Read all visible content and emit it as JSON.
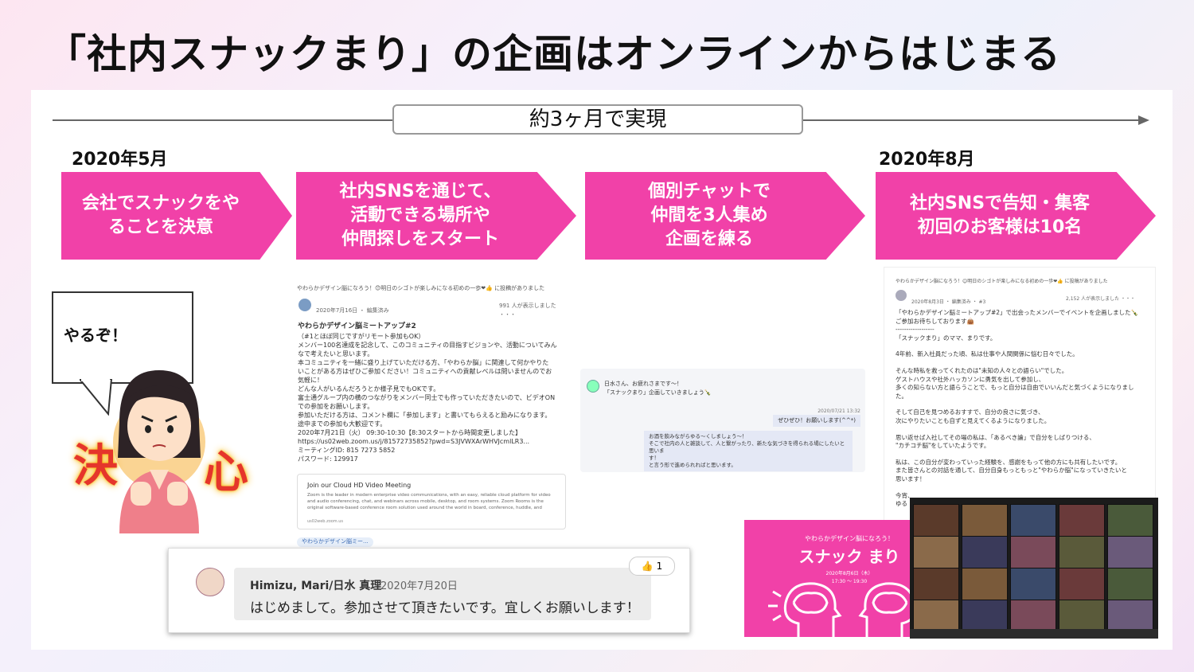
{
  "title": "「社内スナックまり」の企画はオンラインからはじまる",
  "timeline": {
    "label": "約3ヶ月で実現",
    "start_date": "2020年5月",
    "end_date": "2020年8月"
  },
  "steps": [
    {
      "text": "会社でスナックをや\nることを決意"
    },
    {
      "text": "社内SNSを通じて、\n活動できる場所や\n仲間探しをスタート"
    },
    {
      "text": "個別チャットで\n仲間を3人集め\n企画を練る"
    },
    {
      "text": "社内SNSで告知・集客\n初回のお客様は10名"
    }
  ],
  "illustration": {
    "speech": "やるぞ！",
    "kanji_left": "決",
    "kanji_right": "心"
  },
  "sns_post1": {
    "header": "やわらかデザイン脳になろう！😊明日のシゴトが楽しみになる初めの一歩❤👍 に投稿がありました",
    "meta": "2020年7月16日 ・ 編集済み",
    "views": "991 人が表示しました ・・・",
    "heading": "やわらかデザイン脳ミートアップ#2",
    "lines": [
      "（#1とほぼ同じですがリモート参加もOK）",
      "メンバー100名達成を記念して、このコミュニティの目指すビジョンや、活動についてみん",
      "なで考えたいと思います。",
      "本コミュニティを一緒に盛り上げていただける方、「やわらか脳」に関連して何かやりた",
      "いことがある方はぜひご参加ください！コミュニティへの貢献レベルは問いませんのでお",
      "気軽に！",
      "どんな人がいるんだろうとか様子見でもOKです。",
      "富士通グループ内の横のつながりをメンバー同士でも作っていただきたいので、ビデオON",
      "での参加をお願いします。",
      "参加いただける方は、コメント欄に「参加します」と書いてもらえると励みになります。",
      "途中までの参加も大歓迎です。",
      "2020年7月21日（火） 09:30-10:30【8:30スタートから時間変更しました】",
      "https://us02web.zoom.us/j/81572735852?pwd=S3JVWXArWHVJcmlLR3...",
      "ミーティングID: 815 7273 5852",
      "パスワード: 129917"
    ],
    "card_title": "Join our Cloud HD Video Meeting",
    "card_body": "Zoom is the leader in modern enterprise video communications, with an easy, reliable cloud platform for video and audio conferencing, chat, and webinars across mobile, desktop, and room systems. Zoom Rooms is the original software-based conference room solution used around the world in board, conference, huddle, and",
    "card_url": "us02web.zoom.us",
    "tag": "やわらかデザイン脳ミー..."
  },
  "chat": {
    "msg1": "日水さん、お疲れさまです～！\n「スナックまり」企画していきましょう🍾",
    "time": "2020/07/21 13:32",
    "msg2": "ぜひぜひ！お願いします(^^*)",
    "msg3": "お酒を飲みながらゆる～くしましょう～！\nそこで社内の人と雑談して、人と繋がったり、新たな気づきを得られる場にしたいと思いま\nす！\nと言う形で進められればと思います。"
  },
  "sns_post2": {
    "header": "やわらかデザイン脳になろう！😊明日のシゴトが楽しみになる初めの一歩❤👍 に投稿がありました",
    "meta": "2020年8月3日 ・ 編集済み ・ #3",
    "views": "2,152 人が表示しました ・・・",
    "lines": [
      "「やわらかデザイン脳ミートアップ#2」で出会ったメンバーでイベントを企画しました🍾",
      "ご参加お待ちしております👜",
      "------------------",
      "「スナックまり」のママ、まりです。",
      "",
      "4年前、新入社員だった頃、私は仕事や人間関係に悩む日々でした。",
      "",
      "そんな時私を救ってくれたのは\"未知の人々との語らい\"でした。",
      "ゲストハウスや社外ハッカソンに勇気を出して参加し、",
      "多くの知らない方と語らうことで、もっと自分は自由でいいんだと気づくようになりまし",
      "た。",
      "",
      "そして自己を見つめるおすすで、自分の良さに気づき、",
      "次にやりたいことも自ずと見えてくるようになりました。",
      "",
      "思い返せば入社してその場の私は、「あるべき論」で自分をしばりつける、",
      "\"カチコチ脳\"をしていたようです。",
      "",
      "私は、この自分が変わっていった経験を、感謝をもって他の方にも共有したいです。",
      "また皆さんとの対話を通して、自分自身もっともっと\"やわらか脳\"になっていきたいと",
      "思います！",
      "",
      "今宵、",
      "ゆる"
    ]
  },
  "comment": {
    "name": "Himizu, Mari/日水 真理",
    "date": "2020年7月20日",
    "text": "はじめまして。参加させて頂きたいです。宜しくお願いします！",
    "likes": "1"
  },
  "flyer": {
    "subtitle": "やわらかデザイン脳になろう！",
    "title": "スナック まり",
    "date": "2020年8月6日（木）",
    "time": "17:30 ～ 19:30"
  },
  "colors": {
    "accent": "#f141a8",
    "text": "#111111"
  }
}
